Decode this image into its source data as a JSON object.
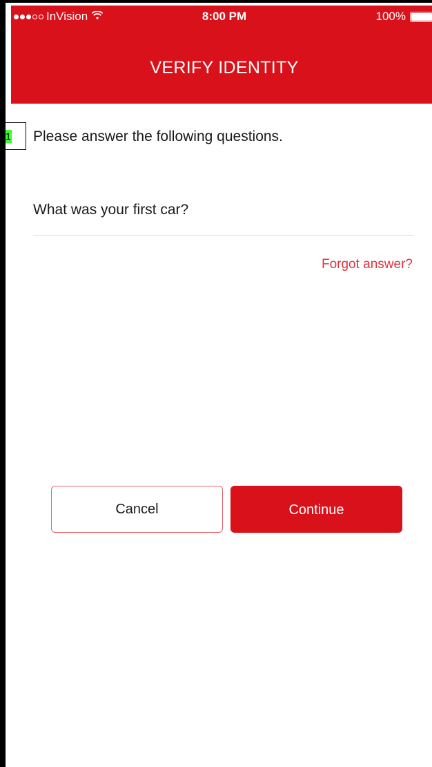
{
  "status_bar": {
    "carrier": "InVision",
    "signal_dots_filled": 3,
    "signal_dots_total": 5,
    "time": "8:00 PM",
    "battery_percent": "100%"
  },
  "nav": {
    "title": "VERIFY IDENTITY"
  },
  "content": {
    "intro": "Please answer the following questions.",
    "question": "What was your first car?",
    "answer_value": "",
    "forgot_link": "Forgot answer?"
  },
  "actions": {
    "cancel_label": "Cancel",
    "continue_label": "Continue"
  },
  "marker": {
    "label": "1"
  },
  "colors": {
    "brand_red": "#d9111b",
    "link_red": "#e0343f",
    "cancel_border": "#e7646b",
    "marker_green": "#39ff2e"
  }
}
